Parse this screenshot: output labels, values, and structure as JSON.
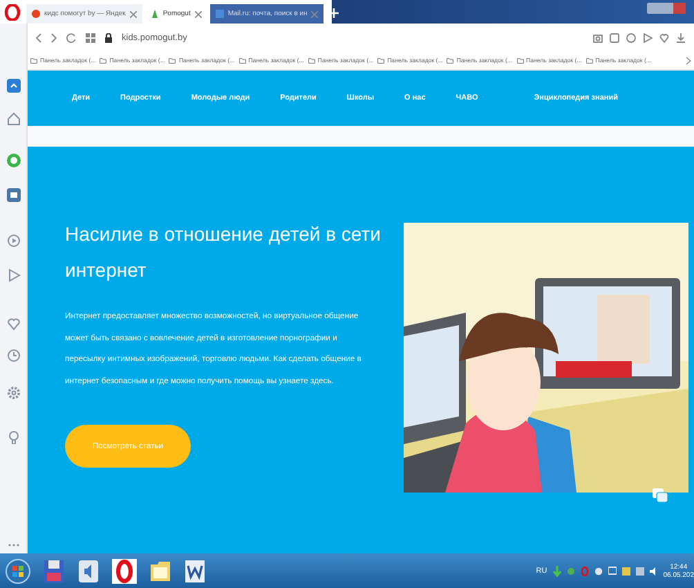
{
  "browser": {
    "tabs": [
      {
        "label": "кидс помогут by — Яндек",
        "selected": false
      },
      {
        "label": "Pomogut",
        "selected": true
      },
      {
        "label": "Mail.ru: почта, поиск в ин",
        "selected": false
      }
    ],
    "address": "kids.pomogut.by",
    "bookmarks": [
      "Панель закладок (...",
      "Панель закладок (...",
      "Панель закладок (...",
      "Панель закладок (...",
      "Панель закладок (...",
      "Панель закладок (...",
      "Панель закладок (...",
      "Панель закладок (...",
      "Панель закладок (..."
    ]
  },
  "site": {
    "nav": [
      "Дети",
      "Подростки",
      "Молодые люди",
      "Родители",
      "Школы",
      "О нас",
      "ЧАВО"
    ],
    "nav_right": "Энциклопедия знаний",
    "hero": {
      "title": "Насилие в отношение детей в сети интернет",
      "text": "Интернет предоставляет множество возможностей, но виртуальное общение может быть связано с вовлечение детей в изготовление порнографии и пересылку интимных изображений, торговлю людьми. Как сделать общение в интернет безопасным и где можно получить помощь вы узнаете здесь.",
      "button": "Посмотреть статьи"
    }
  },
  "taskbar": {
    "language": "RU",
    "time": "12:44",
    "date": "06.05.202"
  }
}
